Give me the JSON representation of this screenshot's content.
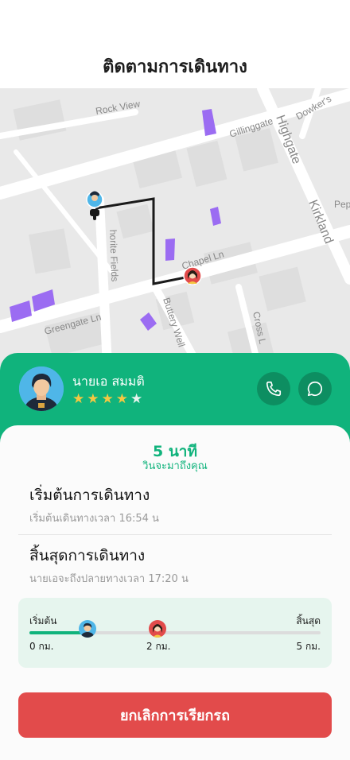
{
  "header": {
    "title": "ติดตามการเดินทาง"
  },
  "map": {
    "streets": [
      "Rock View",
      "Gillinggate",
      "Highgate",
      "Dowker's",
      "Kirkland",
      "Pepp",
      "Chapel Ln",
      "Buttery Well",
      "Greengate Ln",
      "Cross L",
      "horite Fields"
    ]
  },
  "driver": {
    "name": "นายเอ สมมติ",
    "rating": 4,
    "max_rating": 5,
    "icons": {
      "phone": "phone-icon",
      "chat": "chat-bubble-icon"
    }
  },
  "trip": {
    "eta_value": "5 นาที",
    "eta_label": "วินจะมาถึงคุณ",
    "start_title": "เริ่มต้นการเดินทาง",
    "start_sub": "เริ่มต้นเดินทางเวลา 16:54 น",
    "end_title": "สิ้นสุดการเดินทาง",
    "end_sub": "นายเอจะถึงปลายทางเวลา 17:20 น"
  },
  "progress": {
    "start_label": "เริ่มต้น",
    "end_label": "สิ้นสุด",
    "tick_start": "0 กม.",
    "tick_mid": "2 กม.",
    "tick_end": "5 กม.",
    "driver_fraction": 0.2,
    "pickup_fraction": 0.44
  },
  "actions": {
    "cancel_label": "ยกเลิกการเรียกรถ"
  },
  "colors": {
    "accent": "#10b37c",
    "danger": "#e24b4b",
    "star": "#f5c842",
    "building": "#9b6cf2"
  }
}
